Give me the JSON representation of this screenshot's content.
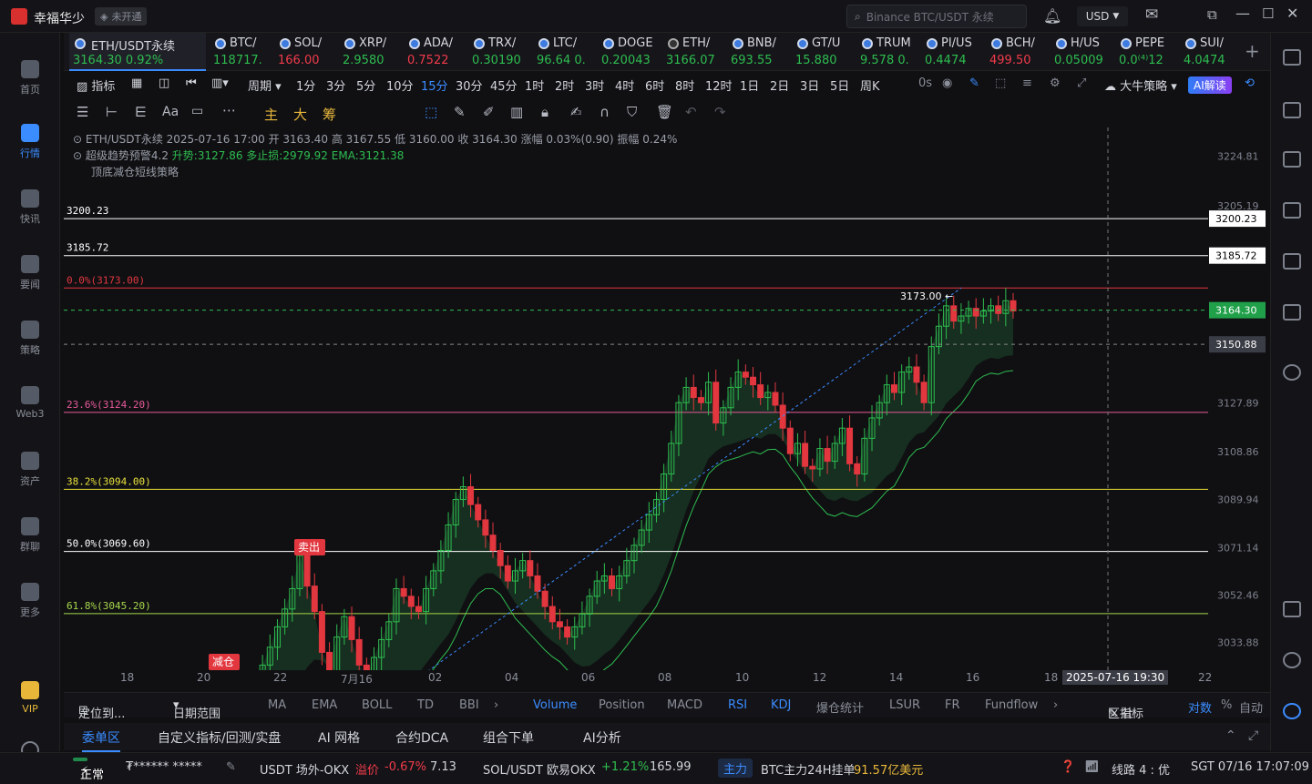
{
  "app": {
    "title": "幸福华少",
    "badge": "未开通",
    "search_placeholder": "Binance BTC/USDT 永续",
    "currency": "USD"
  },
  "sidebar": {
    "items": [
      {
        "label": "首页"
      },
      {
        "label": "行情"
      },
      {
        "label": "快讯"
      },
      {
        "label": "要闻"
      },
      {
        "label": "策略"
      },
      {
        "label": "Web3"
      },
      {
        "label": "资产"
      },
      {
        "label": "群聊"
      },
      {
        "label": "更多"
      },
      {
        "label": "VIP"
      }
    ]
  },
  "tickers": [
    {
      "name": "ETH/USDT永续",
      "price": "3164.30",
      "change": "0.92%"
    },
    {
      "name": "BTC/",
      "price": "118717.",
      "change": ""
    },
    {
      "name": "SOL/",
      "price": "166.00",
      "change": ""
    },
    {
      "name": "XRP/",
      "price": "2.9580",
      "change": ""
    },
    {
      "name": "ADA/",
      "price": "0.7522",
      "change": ""
    },
    {
      "name": "TRX/",
      "price": "0.30190",
      "change": ""
    },
    {
      "name": "LTC/",
      "price": "96.64",
      "change": "0."
    },
    {
      "name": "DOGE",
      "price": "0.20043",
      "change": ""
    },
    {
      "name": "ETH/",
      "price": "3166.07",
      "change": ""
    },
    {
      "name": "BNB/",
      "price": "693.55",
      "change": ""
    },
    {
      "name": "GT/U",
      "price": "15.880",
      "change": ""
    },
    {
      "name": "TRUM",
      "price": "9.578",
      "change": "0."
    },
    {
      "name": "PI/US",
      "price": "0.4474",
      "change": ""
    },
    {
      "name": "BCH/",
      "price": "499.50",
      "change": ""
    },
    {
      "name": "H/US",
      "price": "0.05009",
      "change": ""
    },
    {
      "name": "PEPE",
      "price": "0.0⁽⁴⁾12",
      "change": ""
    },
    {
      "name": "SUI/",
      "price": "4.0474",
      "change": ""
    }
  ],
  "toolbar": {
    "indicators": "指标",
    "period": "周期",
    "intervals": [
      "1分",
      "3分",
      "5分",
      "10分",
      "15分",
      "30分",
      "45分",
      "1时",
      "2时",
      "3时",
      "4时",
      "6时",
      "8时",
      "12时",
      "1日",
      "2日",
      "3日",
      "5日",
      "周K"
    ],
    "active": "15分",
    "countdown": "0s",
    "strategy": "大牛策略",
    "ai": "AI解读",
    "main": "主",
    "big": "大",
    "chip": "筹"
  },
  "info": {
    "line1": "ETH/USDT永续 2025-07-16 17:00 开 3163.40 高 3167.55 低 3160.00 收 3164.30 涨幅 0.03%(0.90) 振幅 0.24%",
    "line2a": "超级趋势预警4.2",
    "line2b": "升势:3127.86 多止损:2979.92 EMA:3121.38",
    "line3": "顶底减仓短线策略"
  },
  "chart_data": {
    "type": "candlestick",
    "symbol": "ETH/USDT永续",
    "interval": "15分",
    "ylim": [
      3023,
      3236
    ],
    "yticks": [
      3224.81,
      3205.19,
      3127.89,
      3108.86,
      3089.94,
      3071.14,
      3052.46,
      3033.88
    ],
    "xticks": [
      "18",
      "20",
      "22",
      "7月16",
      "02",
      "04",
      "06",
      "08",
      "10",
      "12",
      "14",
      "16",
      "18",
      "22"
    ],
    "crosshair_x": "2025-07-16 19:30",
    "last_price": "3164.30",
    "cursor_price": "3150.88",
    "levels": [
      {
        "price": 3200.23,
        "label": "3200.23",
        "color": "#ffffff"
      },
      {
        "price": 3185.72,
        "label": "3185.72",
        "color": "#ffffff"
      },
      {
        "price": 3173.0,
        "label": "0.0%(3173.00)",
        "color": "#e2373f"
      },
      {
        "price": 3124.2,
        "label": "23.6%(3124.20)",
        "color": "#e85a9a"
      },
      {
        "price": 3094.0,
        "label": "38.2%(3094.00)",
        "color": "#e8e03a"
      },
      {
        "price": 3069.6,
        "label": "50.0%(3069.60)",
        "color": "#ffffff"
      },
      {
        "price": 3045.2,
        "label": "61.8%(3045.20)",
        "color": "#a6d84a"
      }
    ],
    "annotations": [
      {
        "text": "卖出"
      },
      {
        "text": "减仓"
      },
      {
        "text": "3173.00 ←"
      }
    ],
    "series": [
      {
        "name": "close",
        "values": [
          3018,
          3025,
          3032,
          3040,
          3047,
          3055,
          3068,
          3056,
          3046,
          3030,
          3022,
          3036,
          3044,
          3035,
          3025,
          3020,
          3028,
          3035,
          3042,
          3055,
          3052,
          3048,
          3046,
          3055,
          3062,
          3070,
          3080,
          3090,
          3095,
          3088,
          3082,
          3076,
          3070,
          3064,
          3058,
          3062,
          3066,
          3060,
          3054,
          3048,
          3042,
          3040,
          3036,
          3040,
          3045,
          3052,
          3058,
          3060,
          3055,
          3060,
          3066,
          3072,
          3078,
          3084,
          3090,
          3100,
          3112,
          3128,
          3134,
          3130,
          3128,
          3136,
          3120,
          3126,
          3134,
          3140,
          3138,
          3135,
          3130,
          3132,
          3127,
          3118,
          3108,
          3112,
          3103,
          3102,
          3110,
          3105,
          3112,
          3118,
          3104,
          3100,
          3114,
          3122,
          3128,
          3135,
          3132,
          3140,
          3142,
          3136,
          3128,
          3150,
          3158,
          3166,
          3160,
          3162,
          3165,
          3162,
          3164,
          3166,
          3163,
          3168,
          3164
        ]
      }
    ]
  },
  "bottom": {
    "locate": "定位到...",
    "range": "日期范围",
    "indicators": [
      "MA",
      "EMA",
      "BOLL",
      "TD",
      "BBI",
      "Volume",
      "Position",
      "MACD",
      "RSI",
      "KDJ",
      "爆仓统计",
      "LSUR",
      "FR",
      "Fundflow"
    ],
    "right": [
      "区指标",
      "对数",
      "%",
      "自动"
    ]
  },
  "tabs": [
    "委单区",
    "自定义指标/回测/实盘",
    "AI 网格",
    "合约DCA",
    "组合下单",
    "AI分析"
  ],
  "status": {
    "state": "正常",
    "user": "₮****** *****",
    "otc": "USDT 场外-OKX",
    "premium_label": "溢价",
    "premium": "-0.67%",
    "rate": "7.13",
    "pair": "SOL/USDT 欧易OKX",
    "pair_change": "+1.21%",
    "pair_price": "165.99",
    "tag": "主力",
    "btc_label": "BTC主力24H挂单",
    "btc_value": "91.57亿美元",
    "line": "线路 4 : 优",
    "time": "SGT 07/16 17:07:09"
  }
}
